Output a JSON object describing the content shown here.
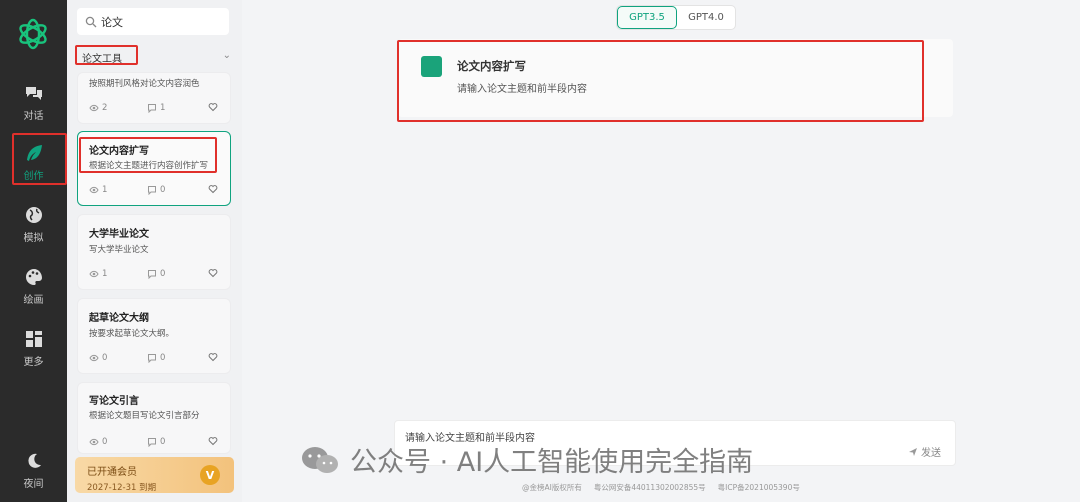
{
  "nav": {
    "items": [
      {
        "label": "对话",
        "icon": "chat-bubbles-icon"
      },
      {
        "label": "创作",
        "icon": "feather-icon"
      },
      {
        "label": "模拟",
        "icon": "globe-icon"
      },
      {
        "label": "绘画",
        "icon": "palette-icon"
      },
      {
        "label": "更多",
        "icon": "grid-icon"
      },
      {
        "label": "夜间",
        "icon": "moon-icon"
      }
    ],
    "active": "创作"
  },
  "sidebar": {
    "search_value": "论文",
    "category": "论文工具",
    "cards": [
      {
        "title": "",
        "desc": "按照期刊风格对论文内容润色",
        "views": "2",
        "comments": "1"
      },
      {
        "title": "论文内容扩写",
        "desc": "根据论文主题进行内容创作扩写",
        "views": "1",
        "comments": "0"
      },
      {
        "title": "大学毕业论文",
        "desc": "写大学毕业论文",
        "views": "1",
        "comments": "0"
      },
      {
        "title": "起草论文大纲",
        "desc": "按要求起草论文大纲。",
        "views": "0",
        "comments": "0"
      },
      {
        "title": "写论文引言",
        "desc": "根据论文题目写论文引言部分",
        "views": "0",
        "comments": "0"
      }
    ],
    "member": {
      "label": "已开通会员",
      "expiry": "2027-12-31 到期",
      "badge": "V"
    }
  },
  "main": {
    "models": [
      "GPT3.5",
      "GPT4.0"
    ],
    "active_model": "GPT3.5",
    "prompt": {
      "title": "论文内容扩写",
      "desc": "请输入论文主题和前半段内容"
    },
    "input_placeholder": "请输入论文主题和前半段内容",
    "send_label": "发送",
    "footer": [
      "@金榜AI版权所有",
      "粤公网安备44011302002855号",
      "粤ICP备2021005390号"
    ]
  },
  "watermark": "公众号 · AI人工智能使用完全指南",
  "colors": {
    "accent": "#10a37f",
    "annotation": "#e0302b",
    "rail": "#2b2b2b"
  }
}
